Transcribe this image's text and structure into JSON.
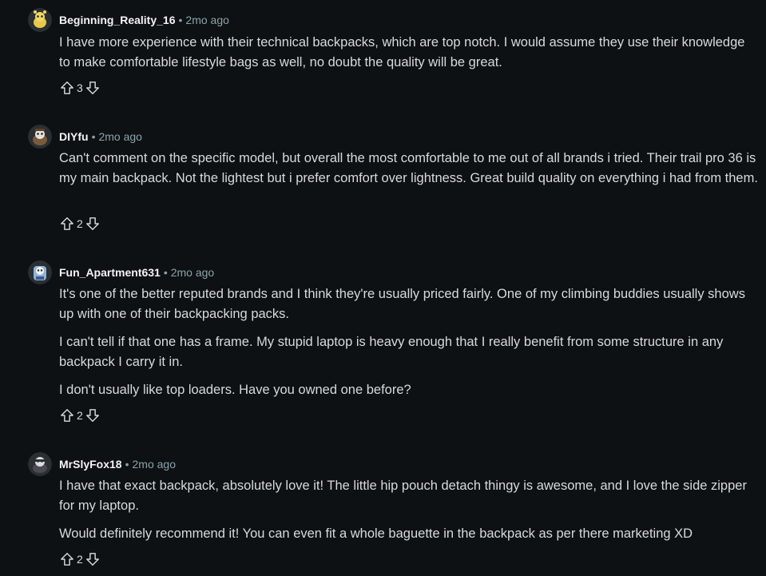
{
  "comments": [
    {
      "username": "Beginning_Reality_16",
      "time": "2mo ago",
      "avatar": "snoo-avatar-yellow",
      "paragraphs": [
        "I have more experience with their technical backpacks, which are top notch. I would assume they use their knowledge to make comfortable lifestyle bags as well, no doubt the quality will be great."
      ],
      "score": "3"
    },
    {
      "username": "DIYfu",
      "time": "2mo ago",
      "avatar": "snoo-avatar-brown",
      "paragraphs": [
        "Can't comment on the specific model, but overall the most comfortable to me out of all brands i tried. Their trail pro 36 is my main backpack. Not the lightest but i prefer comfort over lightness. Great build quality on everything i had from them."
      ],
      "score": "2"
    },
    {
      "username": "Fun_Apartment631",
      "time": "2mo ago",
      "avatar": "snoo-avatar-blue",
      "paragraphs": [
        "It's one of the better reputed brands and I think they're usually priced fairly. One of my climbing buddies usually shows up with one of their backpacking packs.",
        "I can't tell if that one has a frame. My stupid laptop is heavy enough that I really benefit from some structure in any backpack I carry it in.",
        "I don't usually like top loaders. Have you owned one before?"
      ],
      "score": "2"
    },
    {
      "username": "MrSlyFox18",
      "time": "2mo ago",
      "avatar": "snoo-avatar-grey",
      "paragraphs": [
        "I have that exact backpack, absolutely love it! The little hip pouch detach thingy is awesome, and I love the side zipper for my laptop.",
        "Would definitely recommend it! You can even fit a whole baguette in the backpack as per there marketing XD"
      ],
      "score": "2"
    }
  ],
  "separator": "•",
  "icons": {
    "upvote": "upvote-arrow-icon",
    "downvote": "downvote-arrow-icon"
  },
  "colors": {
    "background": "#0e1113",
    "username": "#f2f4f5",
    "meta": "#8ba2ad",
    "text": "#d7dadc"
  }
}
